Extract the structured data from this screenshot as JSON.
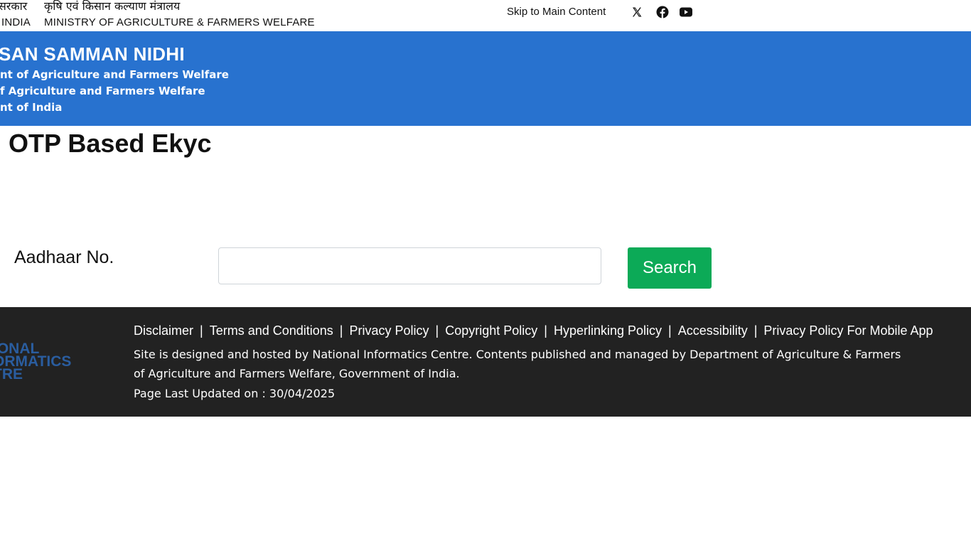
{
  "gov_strip": {
    "hindi_gov": "सरकार",
    "hindi_ministry": "कृषि एवं किसान कल्याण मंत्रालय",
    "english_gov": "INDIA",
    "english_ministry": "MINISTRY OF AGRICULTURE & FARMERS WELFARE",
    "skip_link": "Skip to Main Content",
    "social_icons": [
      "x-icon",
      "facebook-icon",
      "youtube-icon"
    ]
  },
  "header": {
    "title": "SAN SAMMAN NIDHI",
    "line1": "nt of Agriculture and Farmers Welfare",
    "line2": "f Agriculture and Farmers Welfare",
    "line3": "nt of India",
    "bg_color": "#2872cf"
  },
  "main": {
    "page_title": "OTP Based Ekyc",
    "aadhaar_label": "Aadhaar No.",
    "aadhaar_value": "",
    "aadhaar_placeholder": "",
    "search_label": "Search",
    "search_color": "#0caa57"
  },
  "footer": {
    "logo_lines": [
      "IONAL",
      "ORMATICS",
      "TRE"
    ],
    "links": [
      "Disclaimer",
      "Terms and Conditions",
      "Privacy Policy",
      "Copyright Policy",
      "Hyperlinking Policy",
      "Accessibility",
      "Privacy Policy For Mobile App"
    ],
    "text_line1": "Site is designed and hosted by National Informatics Centre. Contents published and managed by Department of Agriculture & Farmers",
    "text_line2": "of Agriculture and Farmers Welfare, Government of India.",
    "last_updated": "Page Last Updated on : 30/04/2025",
    "bg_color": "#222222"
  }
}
